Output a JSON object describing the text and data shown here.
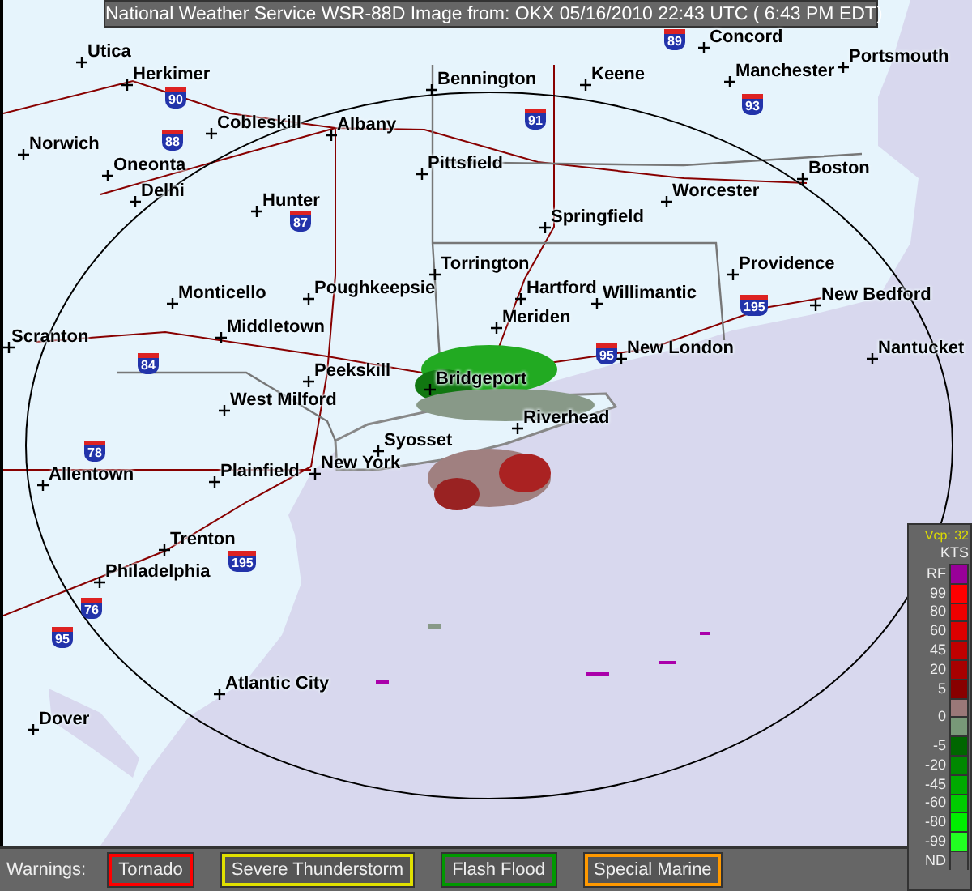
{
  "title": "National Weather Service WSR-88D Image from: OKX 05/16/2010 22:43 UTC ( 6:43 PM EDT)",
  "map": {
    "cities": [
      {
        "name": "Concord"
      },
      {
        "name": "Utica"
      },
      {
        "name": "Portsmouth"
      },
      {
        "name": "Herkimer"
      },
      {
        "name": "Bennington"
      },
      {
        "name": "Keene"
      },
      {
        "name": "Manchester"
      },
      {
        "name": "Cobleskill"
      },
      {
        "name": "Albany"
      },
      {
        "name": "Norwich"
      },
      {
        "name": "Oneonta"
      },
      {
        "name": "Pittsfield"
      },
      {
        "name": "Boston"
      },
      {
        "name": "Delhi"
      },
      {
        "name": "Hunter"
      },
      {
        "name": "Worcester"
      },
      {
        "name": "Springfield"
      },
      {
        "name": "Torrington"
      },
      {
        "name": "Providence"
      },
      {
        "name": "Monticello"
      },
      {
        "name": "Poughkeepsie"
      },
      {
        "name": "Hartford"
      },
      {
        "name": "Willimantic"
      },
      {
        "name": "New Bedford"
      },
      {
        "name": "Scranton"
      },
      {
        "name": "Middletown"
      },
      {
        "name": "Meriden"
      },
      {
        "name": "New London"
      },
      {
        "name": "Nantucket"
      },
      {
        "name": "Peekskill"
      },
      {
        "name": "Bridgeport"
      },
      {
        "name": "West Milford"
      },
      {
        "name": "Riverhead"
      },
      {
        "name": "Syosset"
      },
      {
        "name": "Allentown"
      },
      {
        "name": "Plainfield"
      },
      {
        "name": "New York"
      },
      {
        "name": "Trenton"
      },
      {
        "name": "Philadelphia"
      },
      {
        "name": "Atlantic City"
      },
      {
        "name": "Dover"
      }
    ],
    "highways": [
      {
        "number": "89"
      },
      {
        "number": "90"
      },
      {
        "number": "91"
      },
      {
        "number": "93"
      },
      {
        "number": "88"
      },
      {
        "number": "87"
      },
      {
        "number": "195"
      },
      {
        "number": "84"
      },
      {
        "number": "95"
      },
      {
        "number": "78"
      },
      {
        "number": "195"
      },
      {
        "number": "76"
      },
      {
        "number": "95"
      }
    ]
  },
  "legend": {
    "mode": "Vcp: 32",
    "units": "KTS",
    "labels": [
      "RF",
      "99",
      "80",
      "60",
      "45",
      "20",
      "5",
      "0",
      "-5",
      "-20",
      "-45",
      "-60",
      "-80",
      "-99",
      "ND"
    ],
    "swatches": [
      {
        "color": "#990099"
      },
      {
        "color": "#ff0000"
      },
      {
        "color": "#ee0000"
      },
      {
        "color": "#dd0000"
      },
      {
        "color": "#c00000"
      },
      {
        "color": "#a80000"
      },
      {
        "color": "#880000"
      },
      {
        "color": "#9a7878"
      },
      {
        "color": "#789878"
      },
      {
        "color": "#006600"
      },
      {
        "color": "#008800"
      },
      {
        "color": "#00aa00"
      },
      {
        "color": "#00cc00"
      },
      {
        "color": "#00ee00"
      },
      {
        "color": "#22ff22"
      },
      {
        "color": "#666666"
      }
    ]
  },
  "warnings": {
    "label": "Warnings:",
    "items": [
      {
        "label": "Tornado",
        "color": "#ff0000"
      },
      {
        "label": "Severe Thunderstorm",
        "color": "#e0e000"
      },
      {
        "label": "Flash Flood",
        "color": "#009900"
      },
      {
        "label": "Special Marine",
        "color": "#ff9900"
      }
    ]
  }
}
